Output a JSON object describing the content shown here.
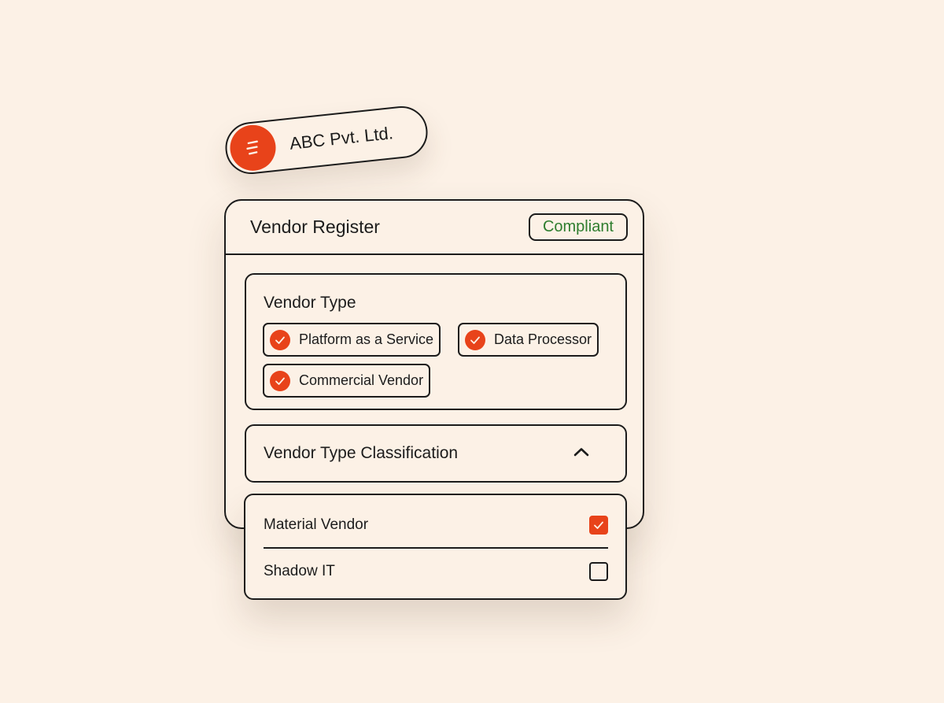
{
  "company": {
    "name": "ABC Pvt. Ltd.",
    "logo_icon": "menu-lines-icon"
  },
  "panel": {
    "title": "Vendor Register",
    "status_badge": "Compliant"
  },
  "vendor_type": {
    "title": "Vendor Type",
    "chips": [
      {
        "label": "Platform as a Service",
        "checked": true
      },
      {
        "label": "Data Processor",
        "checked": true
      },
      {
        "label": "Commercial Vendor",
        "checked": true
      }
    ]
  },
  "classification": {
    "label": "Vendor Type Classification",
    "expanded": true,
    "toggle_icon": "chevron-up-icon"
  },
  "classification_options": [
    {
      "label": "Material Vendor",
      "checked": true
    },
    {
      "label": "Shadow IT",
      "checked": false
    }
  ],
  "colors": {
    "accent": "#e8431a",
    "background": "#fcf1e6",
    "border": "#1c1c1c",
    "status_text": "#2e7d2e"
  }
}
